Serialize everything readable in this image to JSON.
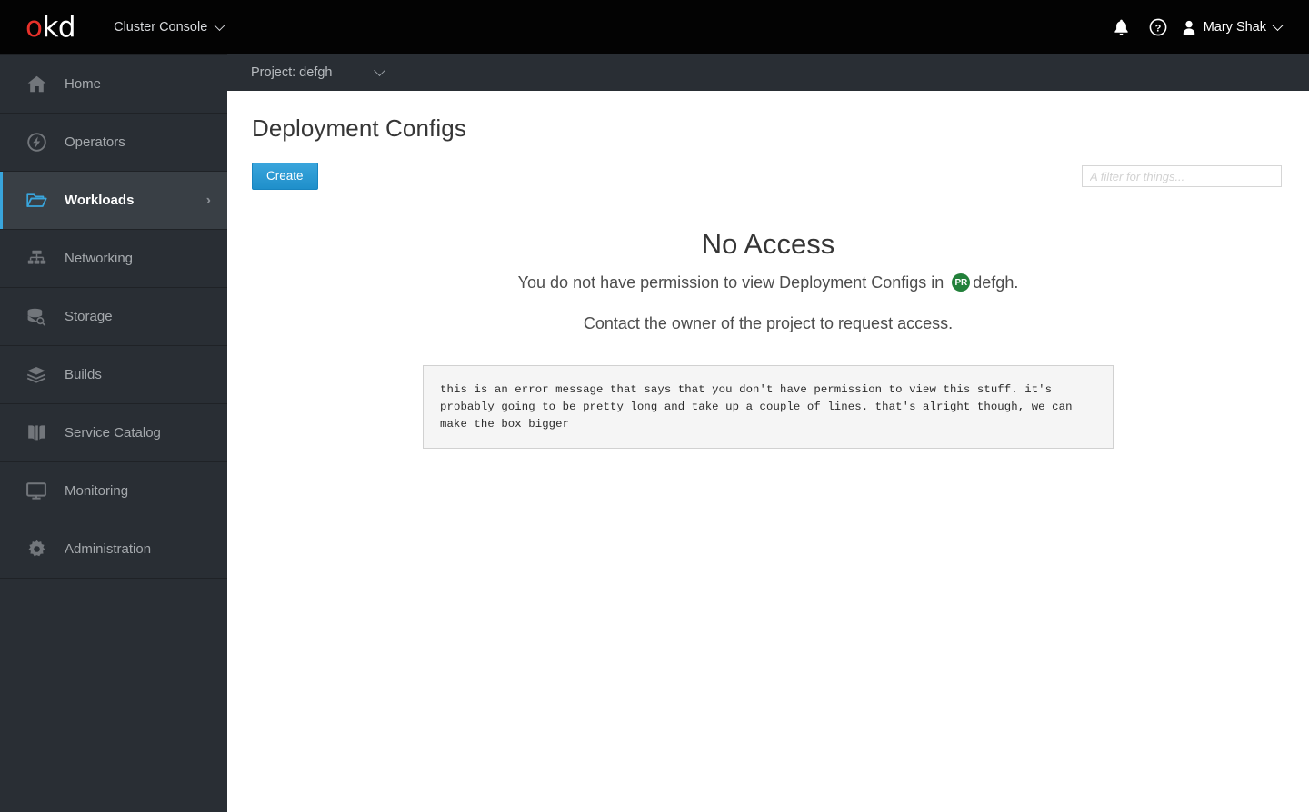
{
  "masthead": {
    "logo_text_primary": "o",
    "logo_text_secondary": "kd",
    "logo_name": "okd",
    "console_switcher_label": "Cluster Console",
    "notifications_icon": "bell-icon",
    "help_icon": "help-circle-icon",
    "user_avatar_icon": "user-icon",
    "user_name": "Mary Shak"
  },
  "project_bar": {
    "label": "Project: defgh",
    "caret_icon": "chevron-down-icon"
  },
  "sidebar": {
    "items": [
      {
        "label": "Home",
        "icon": "home-icon",
        "active": false
      },
      {
        "label": "Operators",
        "icon": "bolt-circle-icon",
        "active": false
      },
      {
        "label": "Workloads",
        "icon": "folder-open-icon",
        "active": true,
        "caret": "›"
      },
      {
        "label": "Networking",
        "icon": "sitemap-icon",
        "active": false
      },
      {
        "label": "Storage",
        "icon": "database-search-icon",
        "active": false
      },
      {
        "label": "Builds",
        "icon": "layers-icon",
        "active": false
      },
      {
        "label": "Service Catalog",
        "icon": "book-open-icon",
        "active": false
      },
      {
        "label": "Monitoring",
        "icon": "monitor-icon",
        "active": false
      },
      {
        "label": "Administration",
        "icon": "gear-icon",
        "active": false
      }
    ]
  },
  "main": {
    "page_title": "Deployment Configs",
    "create_label": "Create",
    "filter_placeholder": "A filter for things...",
    "filter_value": "",
    "empty_state": {
      "title": "No Access",
      "line1_prefix": "You do not have permission to view Deployment Configs in",
      "project_badge": "PR",
      "project_name": "defgh.",
      "line2": "Contact the owner of the project to request access.",
      "error_message": "this is an error message that says that you don't have permission to view this stuff. it's probably going to be pretty long and take up a couple of lines. that's alright though, we can make the box bigger"
    }
  },
  "colors": {
    "masthead_bg": "#030303",
    "sidebar_bg": "#292e34",
    "sidebar_active_bg": "#393f45",
    "accent_blue": "#39a5dc",
    "badge_green": "#22803a",
    "content_bg": "#ffffff",
    "error_box_bg": "#f5f5f5"
  }
}
